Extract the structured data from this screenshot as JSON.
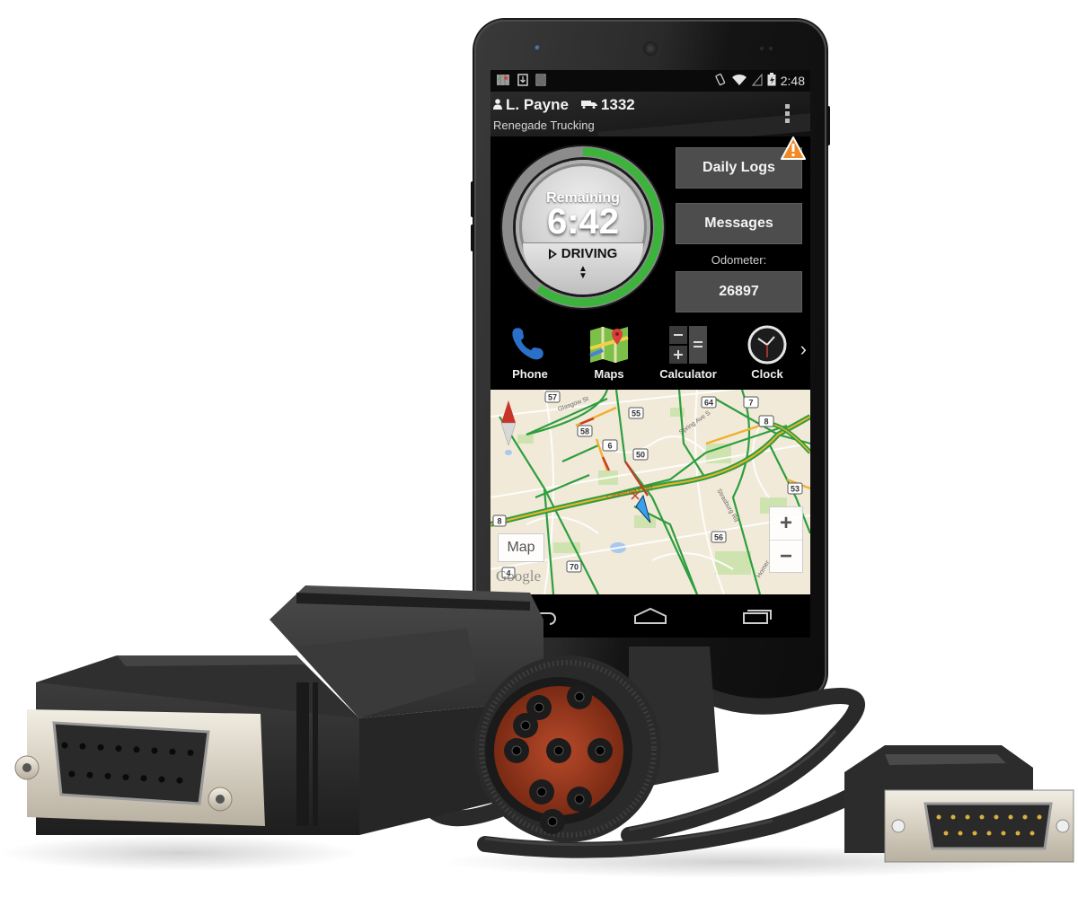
{
  "status_bar": {
    "left_icons": [
      "maps-notification-icon",
      "download-icon",
      "barcode-icon"
    ],
    "right_icons": [
      "rotate-icon",
      "wifi-icon",
      "signal-icon",
      "battery-charging-icon"
    ],
    "time": "2:48"
  },
  "header": {
    "driver_name": "L. Payne",
    "truck_number": "1332",
    "company": "Renegade Trucking"
  },
  "gauge": {
    "label": "Remaining",
    "time_remaining": "6:42",
    "status": "DRIVING",
    "progress_fraction": 0.6,
    "accent_color": "#3cb43c"
  },
  "buttons": {
    "daily_logs": "Daily Logs",
    "daily_logs_alert": true,
    "messages": "Messages"
  },
  "odometer": {
    "label": "Odometer:",
    "value": "26897"
  },
  "apps": [
    {
      "label": "Phone",
      "icon": "phone-icon"
    },
    {
      "label": "Maps",
      "icon": "maps-icon"
    },
    {
      "label": "Calculator",
      "icon": "calculator-icon"
    },
    {
      "label": "Clock",
      "icon": "clock-icon"
    }
  ],
  "map": {
    "type_button": "Map",
    "zoom_in": "+",
    "zoom_out": "−",
    "attribution": "Google",
    "route_shields": [
      "57",
      "55",
      "58",
      "6",
      "50",
      "64",
      "7",
      "8",
      "53",
      "56",
      "70",
      "4",
      "8"
    ],
    "street_labels": [
      "Glasgow St",
      "Spring Ave S",
      "Conestoga Pkwy",
      "Strasburg Rd",
      "Homer Watson Blvd"
    ],
    "colors": {
      "background": "#f1ead9",
      "traffic_green": "#2e9e3e",
      "traffic_yellow": "#f0b030",
      "traffic_red": "#c83a2a",
      "park": "#c8e0a8",
      "water": "#9cc0e8",
      "position_marker": "#3aa0e8"
    }
  },
  "nav_bar": [
    "back-icon",
    "home-icon",
    "recent-apps-icon"
  ]
}
